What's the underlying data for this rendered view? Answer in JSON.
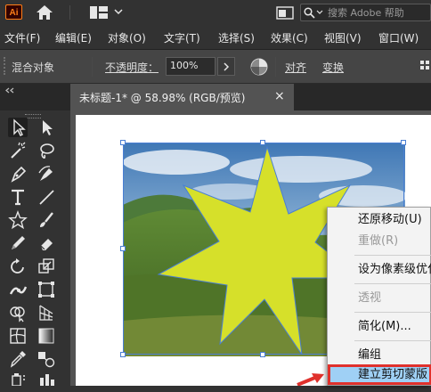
{
  "app": {
    "logo_text": "Ai",
    "search_placeholder": "搜索 Adobe 帮助",
    "brand_color": "#ff7f18"
  },
  "menubar": {
    "items": [
      "文件(F)",
      "编辑(E)",
      "对象(O)",
      "文字(T)",
      "选择(S)",
      "效果(C)",
      "视图(V)",
      "窗口(W)"
    ]
  },
  "controlbar": {
    "object_type": "混合对象",
    "opacity_label": "不透明度：",
    "opacity_value": "100%",
    "align_label": "对齐",
    "transform_label": "变换"
  },
  "document": {
    "tab_title": "未标题-1* @ 58.98% (RGB/预览)",
    "tab_close": "×"
  },
  "tools": [
    "selection-tool-icon",
    "direct-selection-tool-icon",
    "magic-wand-tool-icon",
    "lasso-tool-icon",
    "pen-tool-icon",
    "curvature-tool-icon",
    "type-tool-icon",
    "line-tool-icon",
    "star-tool-icon",
    "paintbrush-tool-icon",
    "pencil-tool-icon",
    "eraser-tool-icon",
    "rotate-tool-icon",
    "scale-tool-icon",
    "width-tool-icon",
    "free-transform-tool-icon",
    "shape-builder-tool-icon",
    "perspective-grid-tool-icon",
    "mesh-tool-icon",
    "gradient-tool-icon",
    "eyedropper-tool-icon",
    "blend-tool-icon",
    "symbol-sprayer-tool-icon",
    "column-graph-tool-icon"
  ],
  "context_menu": {
    "items": [
      {
        "label": "还原移动(U)",
        "enabled": true
      },
      {
        "label": "重做(R)",
        "enabled": false
      },
      {
        "label": "设为像素级优化",
        "enabled": true
      },
      {
        "label": "透视",
        "enabled": false
      },
      {
        "label": "简化(M)...",
        "enabled": true
      },
      {
        "label": "编组",
        "enabled": true
      },
      {
        "label": "建立剪切蒙版",
        "enabled": true,
        "highlighted": true
      }
    ],
    "highlight_color": "#9fd0f5",
    "highlight_border": "#e0312c"
  },
  "artwork": {
    "star_fill": "#d6e02a",
    "selection_color": "#4a7fd4"
  }
}
